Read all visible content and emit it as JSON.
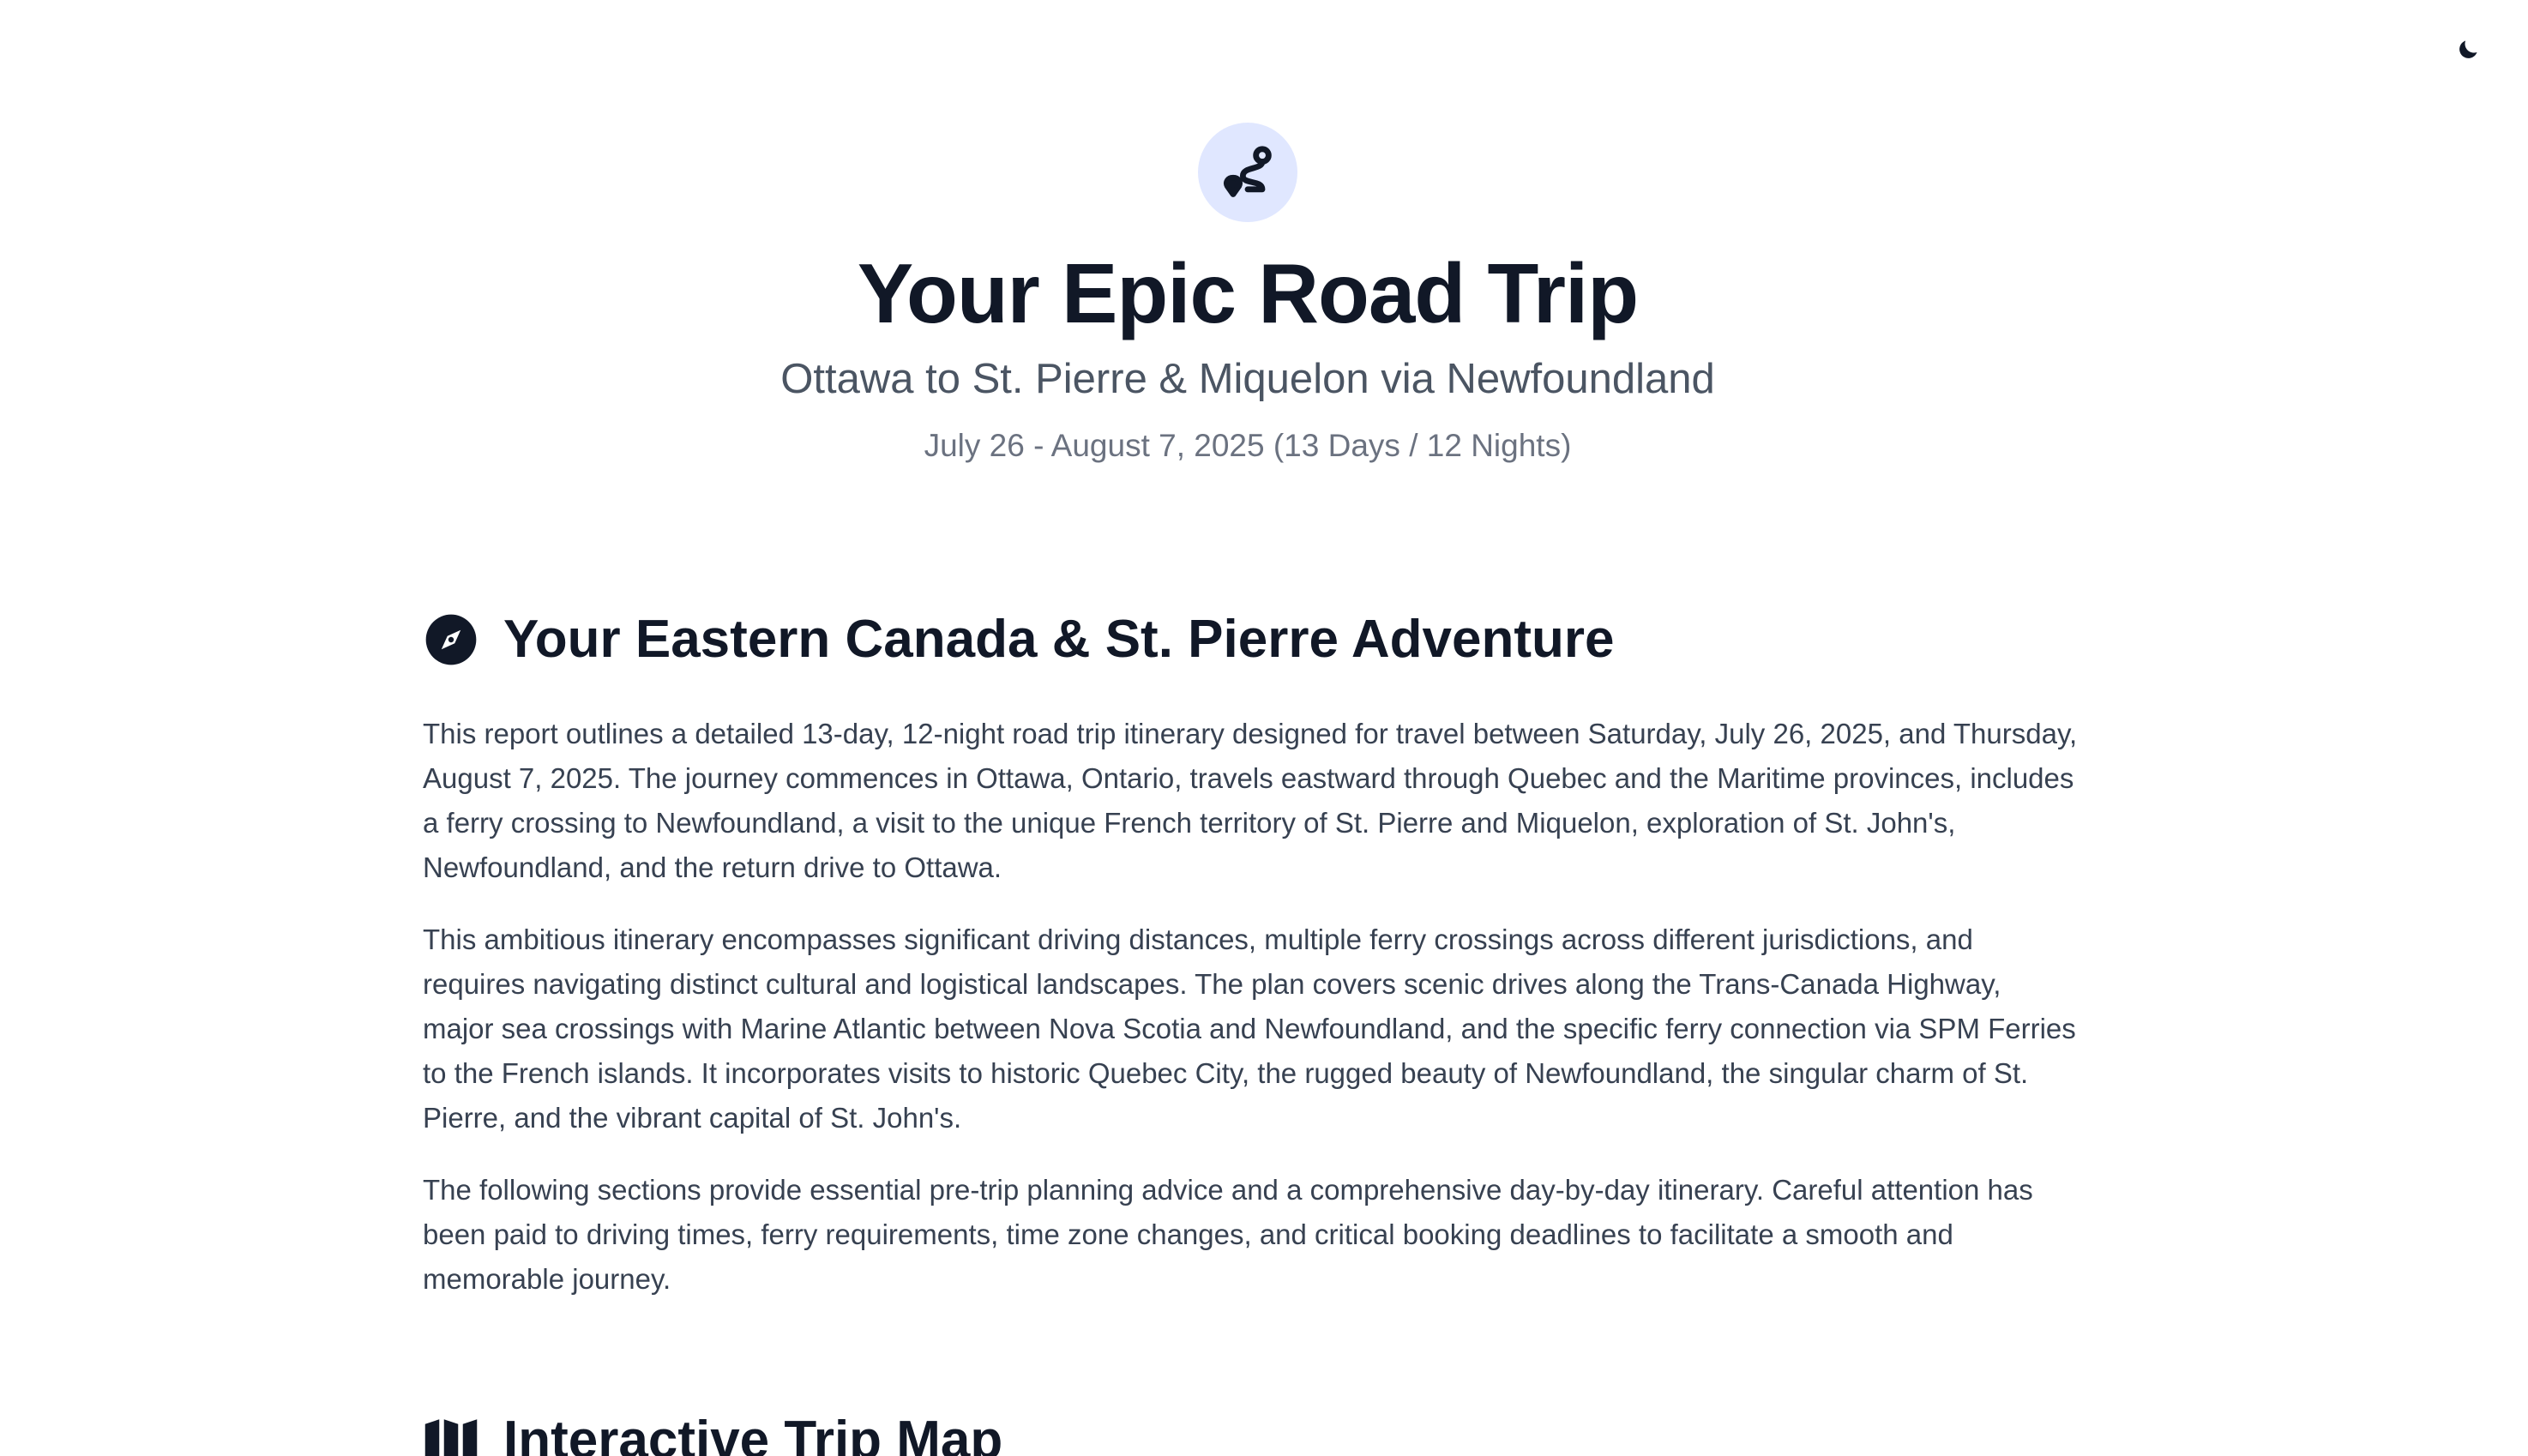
{
  "header": {
    "theme_toggle_icon": "moon-icon",
    "hero_icon": "route-icon",
    "title": "Your Epic Road Trip",
    "subtitle": "Ottawa to St. Pierre & Miquelon via Newfoundland",
    "dates": "July 26 - August 7, 2025 (13 Days / 12 Nights)"
  },
  "overview": {
    "icon": "compass-icon",
    "heading": "Your Eastern Canada & St. Pierre Adventure",
    "paragraphs": [
      "This report outlines a detailed 13-day, 12-night road trip itinerary designed for travel between Saturday, July 26, 2025, and Thursday, August 7, 2025. The journey commences in Ottawa, Ontario, travels eastward through Quebec and the Maritime provinces, includes a ferry crossing to Newfoundland, a visit to the unique French territory of St. Pierre and Miquelon, exploration of St. John's, Newfoundland, and the return drive to Ottawa.",
      "This ambitious itinerary encompasses significant driving distances, multiple ferry crossings across different jurisdictions, and requires navigating distinct cultural and logistical landscapes. The plan covers scenic drives along the Trans-Canada Highway, major sea crossings with Marine Atlantic between Nova Scotia and Newfoundland, and the specific ferry connection via SPM Ferries to the French islands. It incorporates visits to historic Quebec City, the rugged beauty of Newfoundland, the singular charm of St. Pierre, and the vibrant capital of St. John's.",
      "The following sections provide essential pre-trip planning advice and a comprehensive day-by-day itinerary. Careful attention has been paid to driving times, ferry requirements, time zone changes, and critical booking deadlines to facilitate a smooth and memorable journey."
    ]
  },
  "map_section": {
    "icon": "map-icon",
    "heading": "Interactive Trip Map"
  }
}
